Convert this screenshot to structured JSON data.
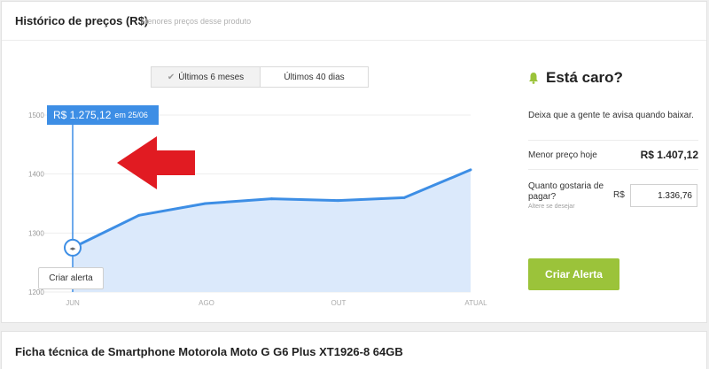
{
  "header": {
    "title": "Histórico de preços (R$)",
    "subtitle": "Menores preços desse produto"
  },
  "tabs": [
    {
      "label": "Últimos 6 meses",
      "active": true
    },
    {
      "label": "Últimos 40 dias",
      "active": false
    }
  ],
  "chart_data": {
    "type": "area",
    "categories": [
      "JUN",
      "AGO",
      "OUT",
      "ATUAL"
    ],
    "y_ticks": [
      "1500",
      "1400",
      "1300",
      "1200"
    ],
    "ylim": [
      1200,
      1500
    ],
    "points": [
      1275.12,
      1330,
      1350,
      1358,
      1355,
      1360,
      1407.12
    ],
    "line_color": "#3d8ee5",
    "fill_color": "#dbe9fb",
    "grid": true
  },
  "tooltip": {
    "price": "R$ 1.275,12",
    "date": "em 25/06"
  },
  "small_alert_button": "Criar alerta",
  "panel": {
    "title": "Está caro?",
    "description": "Deixa que a gente te avisa quando baixar.",
    "lowest_label": "Menor preço hoje",
    "lowest_value": "R$ 1.407,12",
    "ask_label": "Quanto gostaria de pagar?",
    "hint": "Altere se desejar",
    "currency": "R$",
    "input_value": "1.336,76",
    "button_label": "Criar Alerta",
    "accent": "#9bc33a"
  },
  "spec_title": "Ficha técnica de Smartphone Motorola Moto G G6 Plus XT1926-8 64GB"
}
